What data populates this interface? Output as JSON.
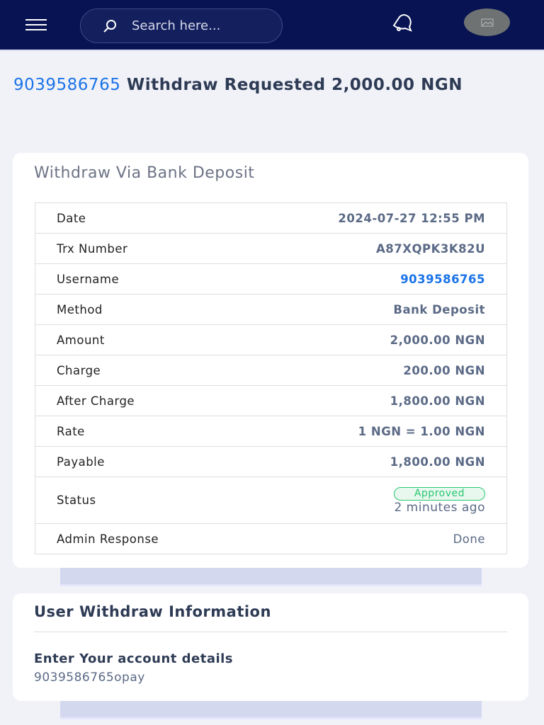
{
  "header": {
    "search_placeholder": "Search here..."
  },
  "heading": {
    "username": "9039586765",
    "text": "Withdraw Requested 2,000.00 NGN"
  },
  "details": {
    "title": "Withdraw Via Bank Deposit",
    "rows": [
      {
        "label": "Date",
        "value": "2024-07-27 12:55 PM"
      },
      {
        "label": "Trx Number",
        "value": "A87XQPK3K82U"
      },
      {
        "label": "Username",
        "value": "9039586765"
      },
      {
        "label": "Method",
        "value": "Bank Deposit"
      },
      {
        "label": "Amount",
        "value": "2,000.00 NGN"
      },
      {
        "label": "Charge",
        "value": "200.00 NGN"
      },
      {
        "label": "After Charge",
        "value": "1,800.00 NGN"
      },
      {
        "label": "Rate",
        "value": "1 NGN = 1.00 NGN"
      },
      {
        "label": "Payable",
        "value": "1,800.00 NGN"
      }
    ],
    "status": {
      "label": "Status",
      "badge": "Approved",
      "time": "2 minutes ago"
    },
    "admin": {
      "label": "Admin Response",
      "value": "Done"
    }
  },
  "info": {
    "title": "User Withdraw Information",
    "label": "Enter Your account details",
    "value": "9039586765opay"
  },
  "colors": {
    "nav": "#071352",
    "link": "#1a73e8",
    "approved": "#28c76f"
  }
}
